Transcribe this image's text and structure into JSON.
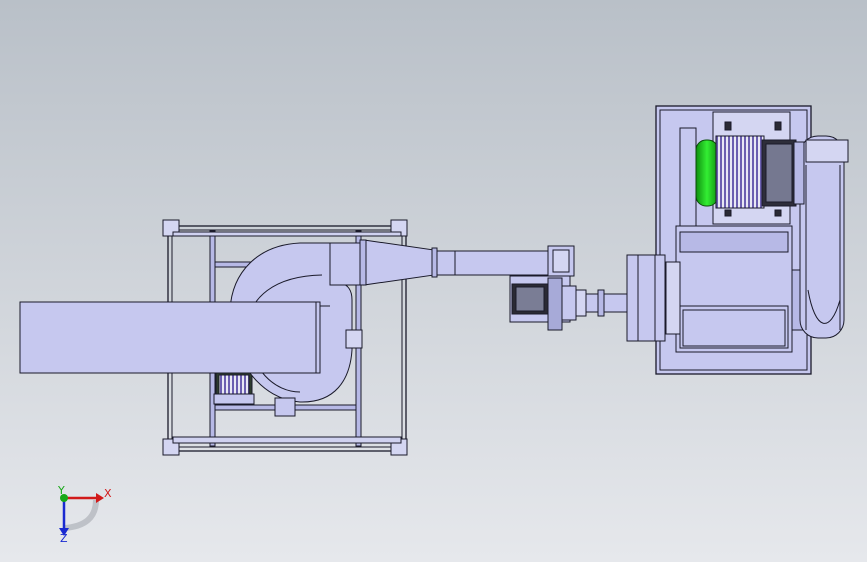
{
  "scene": {
    "background_top": "#b9c0c8",
    "background_bottom": "#e6e8ec",
    "part_fill": "#c6c8ef",
    "part_fill_dark": "#9fa2d6",
    "edge_color": "#1a1a2a",
    "motor_green": "#22cc22",
    "motor_fins": "#6b5fb0"
  },
  "triad": {
    "x_label": "X",
    "y_label": "Y",
    "z_label": "Z",
    "x_color": "#d11a1a",
    "y_color": "#18a818",
    "z_color": "#1a2ad1"
  }
}
